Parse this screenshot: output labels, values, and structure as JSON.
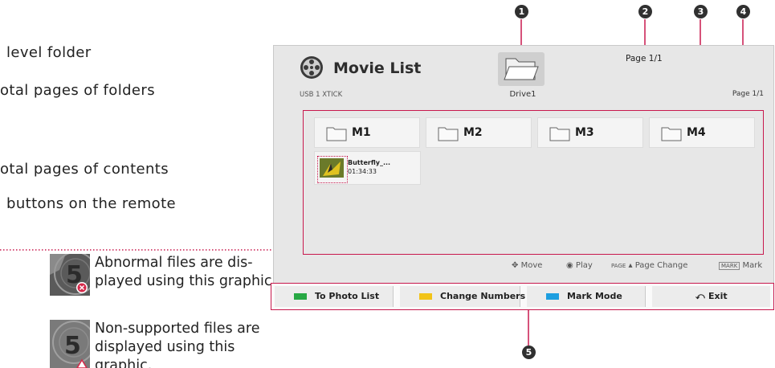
{
  "left_text": {
    "line1": "level folder",
    "line2": "otal pages of folders",
    "line3": "otal pages of contents",
    "line4": "buttons on the remote"
  },
  "thumbnails": [
    {
      "number": "5",
      "note": "Abnormal files are dis-\nplayed using this graphic."
    },
    {
      "number": "5",
      "note": "Non-supported files are displayed using this graphic."
    }
  ],
  "callouts": [
    "1",
    "2",
    "3",
    "4",
    "5"
  ],
  "tv": {
    "title": "Movie List",
    "device": "USB 1 XTICK",
    "drive_label": "Drive1",
    "page_top": "Page 1/1",
    "page_right": "Page 1/1",
    "folders": [
      "M1",
      "M2",
      "M3",
      "M4"
    ],
    "file": {
      "name": "Butterfly_...",
      "duration": "01:34:33"
    },
    "hints": {
      "move": "Move",
      "play": "Play",
      "page_prefix": "PAGE",
      "page_change": "Page Change",
      "mark_key": "MARK",
      "mark": "Mark"
    },
    "buttons": [
      {
        "label": "To Photo List",
        "color": "#27a844"
      },
      {
        "label": "Change Numbers",
        "color": "#f2c318"
      },
      {
        "label": "Mark Mode",
        "color": "#1e9fe0"
      },
      {
        "label": "Exit",
        "icon": "back-icon"
      }
    ]
  },
  "colors": {
    "accent": "#c8184d",
    "callout": "#303030"
  }
}
